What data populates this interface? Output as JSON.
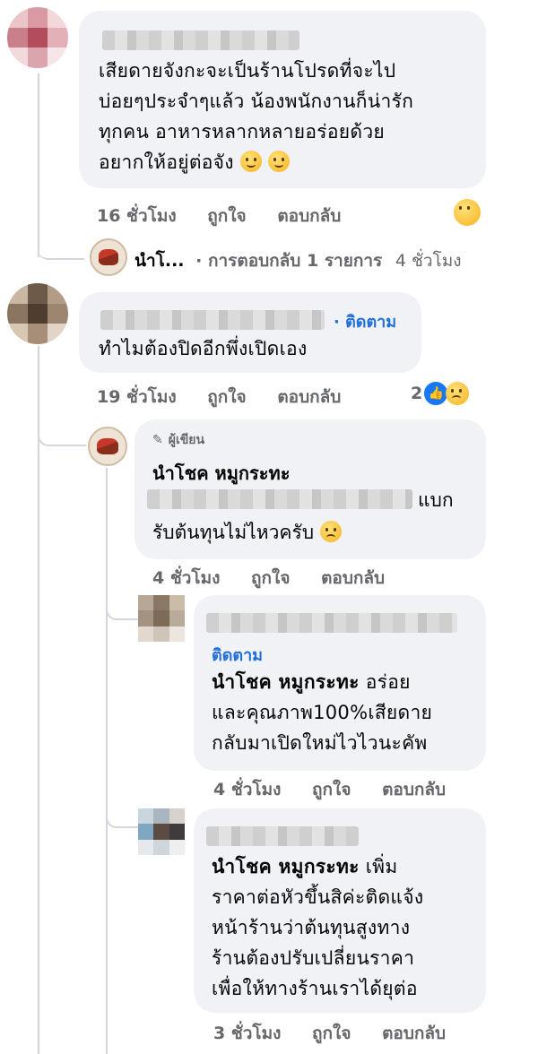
{
  "colors": {
    "bubble": "#f0f2f5",
    "meta": "#65676b",
    "link": "#216fdb",
    "thread": "#d3d6db"
  },
  "comments": [
    {
      "text_lines": [
        "เสียดายจังกะจะเป็นร้านโปรดที่จะไป",
        "บ่อยๆประจำๆแล้ว น้องพนักงานก็น่ารัก",
        "ทุกคน อาหารหลากหลายอร่อยด้วย",
        "อยากให้อยู่ต่อจัง"
      ],
      "time": "16 ชั่วโมง",
      "like": "ถูกใจ",
      "reply": "ตอบกลับ",
      "reaction_icon": "hug-reaction-icon",
      "reply_summary": {
        "name": "นำโ...",
        "text": "· การตอบกลับ 1 รายการ",
        "time": "4 ชั่วโมง"
      }
    },
    {
      "follow": "· ติดตาม",
      "text_lines": [
        "ทำไมต้องปิดอีกพึ่งเปิดเอง"
      ],
      "time": "19 ชั่วโมง",
      "like": "ถูกใจ",
      "reply": "ตอบกลับ",
      "reaction_count": "2",
      "reaction_icons": [
        "like-reaction-icon",
        "sad-reaction-icon"
      ]
    }
  ],
  "replies": [
    {
      "badge": "ผู้เขียน",
      "name": "นำโชค หมูกระทะ",
      "line1_suffix": "แบก",
      "line2": "รับต้นทุนไม่ไหวครับ",
      "time": "4 ชั่วโมง",
      "like": "ถูกใจ",
      "reply": "ตอบกลับ"
    },
    {
      "follow": "ติดตาม",
      "name": "นำโชค หมูกระทะ",
      "name_suffix": " อร่อย",
      "text_lines": [
        "และคุณภาพ100%เสียดาย",
        "กลับมาเปิดใหม่ไวไวนะคัพ"
      ],
      "time": "4 ชั่วโมง",
      "like": "ถูกใจ",
      "reply": "ตอบกลับ"
    },
    {
      "name": "นำโชค หมูกระทะ",
      "name_suffix": " เพิ่ม",
      "text_lines": [
        "ราคาต่อหัวขึ้นสิค่ะติดแจ้ง",
        "หน้าร้านว่าต้นทุนสูงทาง",
        "ร้านต้องปรับเปลี่ยนราคา",
        "เพื่อให้ทางร้านเราได้ยุต่อ"
      ],
      "time": "3 ชั่วโมง",
      "like": "ถูกใจ",
      "reply": "ตอบกลับ"
    }
  ]
}
